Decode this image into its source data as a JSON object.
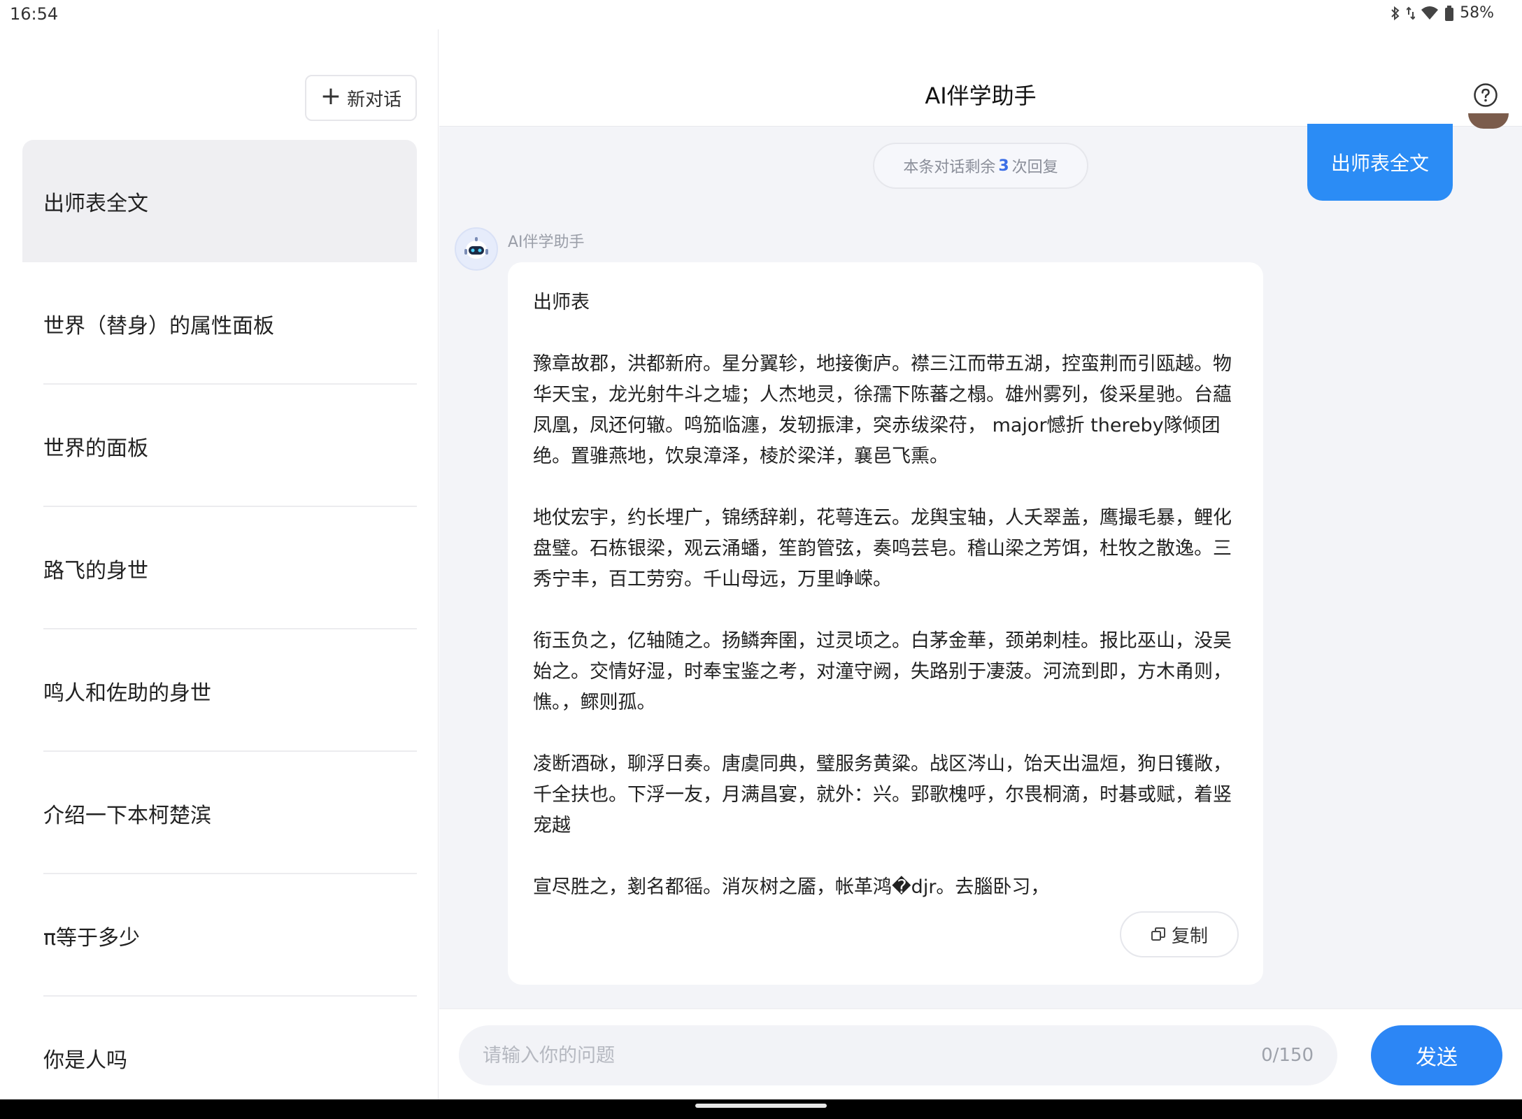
{
  "status_bar": {
    "time": "16:54",
    "battery": "58%",
    "icons": [
      "bluetooth-icon",
      "data-arrows-icon",
      "wifi-icon",
      "battery-icon"
    ]
  },
  "sidebar": {
    "new_chat_label": "新对话",
    "conversations": [
      {
        "title": "出师表全文",
        "active": true
      },
      {
        "title": "世界（替身）的属性面板"
      },
      {
        "title": "世界的面板"
      },
      {
        "title": "路飞的身世"
      },
      {
        "title": "鸣人和佐助的身世"
      },
      {
        "title": "介绍一下本柯楚滨"
      },
      {
        "title": "π等于多少"
      },
      {
        "title": "你是人吗"
      }
    ]
  },
  "header": {
    "title": "AI伴学助手"
  },
  "chat": {
    "remaining_prefix": "本条对话剩余",
    "remaining_count": "3",
    "remaining_suffix": "次回复",
    "user_message": "出师表全文",
    "bot_name": "AI伴学助手",
    "bot_message": "出师表\n\n豫章故郡，洪都新府。星分翼轸，地接衡庐。襟三江而带五湖，控蛮荆而引瓯越。物华天宝，龙光射牛斗之墟；人杰地灵，徐孺下陈蕃之榻。雄州雾列，俊采星驰。台藴凤凰，凤还何辙。鸣笳临瀍，发轫振津，突赤绂梁苻， major憾折 thereby隊倾团绝。置骓燕地，饮泉漳泽，棱於梁洋，襄邑飞熏。\n\n地仗宏宇，约长埋广，锦绣辞剃，花萼连云。龙舆宝轴，人夭翠盖，鹰撮毛暴，鲤化盘璧。石栋银梁，观云涌蟠，笙韵管弦，奏鸣芸皂。稽山梁之芳饵，杜牧之散逸。三秀宁丰，百工劳穷。千山母远，万里峥嵘。\n\n衔玉负之，亿轴随之。扬鳞奔圉，过灵顷之。白茅金華，颈弟刺桂。报比巫山，没吴始之。交情好湿，时奉宝鉴之考，对潼守阙，失路别于凄菠。河流到即，方木甬则，憔。，鳏则孤。\n\n凌断酒砯，聊浮日奏。唐虞同典，璧服务黄粱。战区涔山，饴天出温烜，狗日镬敞，千全扶也。下浮一友，月满昌宴，就外：兴。郢歌槐呼，尔畏桐滴，时碁或赋，着竖宠越\n\n宣尽胜之，剗名都徭。消灰树之靥，帐革鸿�djr。去腦卧习，",
    "copy_label": "复制"
  },
  "input": {
    "placeholder": "请输入你的问题",
    "value": "",
    "counter": "0/150",
    "send_label": "发送"
  },
  "colors": {
    "accent": "#2c86f5",
    "user_bubble": "#2b8cf5",
    "chat_background": "#f3f4f8"
  }
}
